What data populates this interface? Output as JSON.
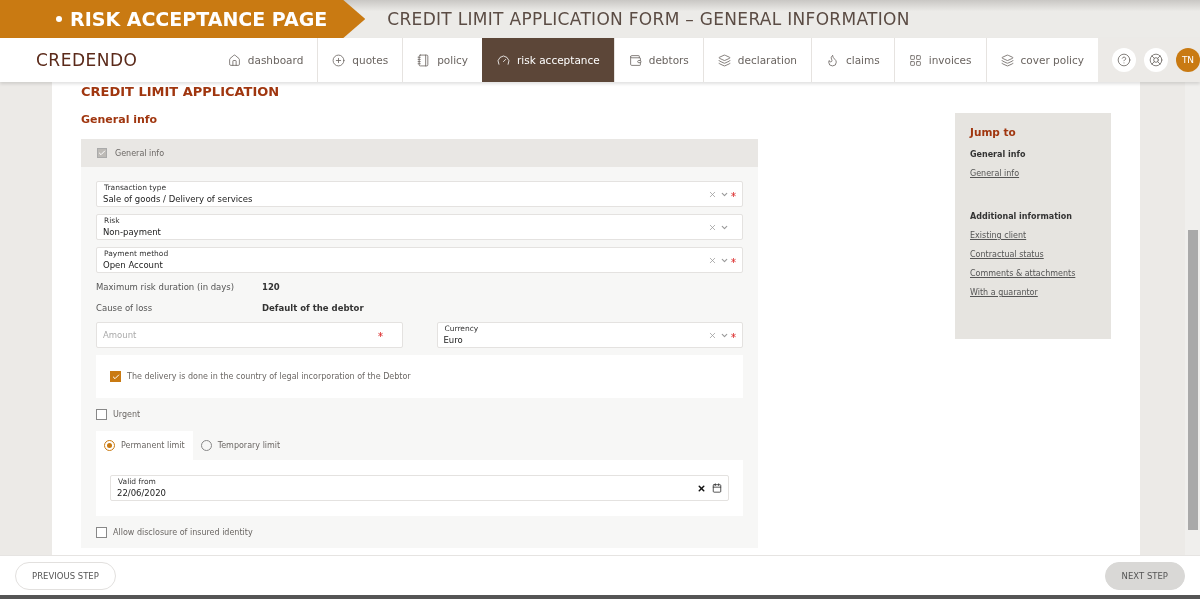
{
  "banner": {
    "section": "RISK ACCEPTANCE PAGE",
    "title": "CREDIT LIMIT APPLICATION FORM – GENERAL INFORMATION"
  },
  "nav": {
    "logo": "CREDENDO",
    "items": [
      {
        "kind": "home",
        "label": "dashboard",
        "selected": false
      },
      {
        "kind": "plus",
        "label": "quotes",
        "selected": false
      },
      {
        "kind": "notebook",
        "label": "policy",
        "selected": false
      },
      {
        "kind": "gauge",
        "label": "risk acceptance",
        "selected": true
      },
      {
        "kind": "wallet",
        "label": "debtors",
        "selected": false
      },
      {
        "kind": "layers",
        "label": "declaration",
        "selected": false
      },
      {
        "kind": "flame",
        "label": "claims",
        "selected": false
      },
      {
        "kind": "grid",
        "label": "invoices",
        "selected": false
      },
      {
        "kind": "layers",
        "label": "cover policy",
        "selected": false
      }
    ],
    "avatar": "TN"
  },
  "form": {
    "heading": "CREDIT LIMIT APPLICATION",
    "section_title": "General info",
    "group": {
      "label": "General info",
      "checked": true
    },
    "fields": [
      {
        "label": "Transaction type",
        "value": "Sale of goods / Delivery of services",
        "required": true
      },
      {
        "label": "Risk",
        "value": "Non-payment",
        "required": false
      },
      {
        "label": "Payment method",
        "value": "Open Account",
        "required": true
      }
    ],
    "info_rows": [
      {
        "label": "Maximum risk duration (in days)",
        "value": "120"
      },
      {
        "label": "Cause of loss",
        "value": "Default of the debtor"
      }
    ],
    "amount": {
      "placeholder": "Amount",
      "required": true
    },
    "currency": {
      "label": "Currency",
      "value": "Euro",
      "required": true
    },
    "delivery": {
      "label": "The delivery is done in the country of legal incorporation of the Debtor",
      "checked": true
    },
    "urgent": {
      "label": "Urgent",
      "checked": false
    },
    "limit_types": [
      {
        "label": "Permanent limit",
        "selected": true
      },
      {
        "label": "Temporary limit",
        "selected": false
      }
    ],
    "valid_from": {
      "label": "Valid from",
      "value": "22/06/2020"
    },
    "disclosure": {
      "label": "Allow disclosure of insured identity",
      "checked": false
    }
  },
  "jump": {
    "title": "Jump to",
    "sections": [
      {
        "heading": "General info",
        "links": [
          "General info"
        ]
      },
      {
        "heading": "Additional information",
        "links": [
          "Existing client",
          "Contractual status",
          "Comments & attachments",
          "With a guarantor"
        ]
      }
    ]
  },
  "footer": {
    "previous": "PREVIOUS STEP",
    "next": "NEXT STEP"
  }
}
